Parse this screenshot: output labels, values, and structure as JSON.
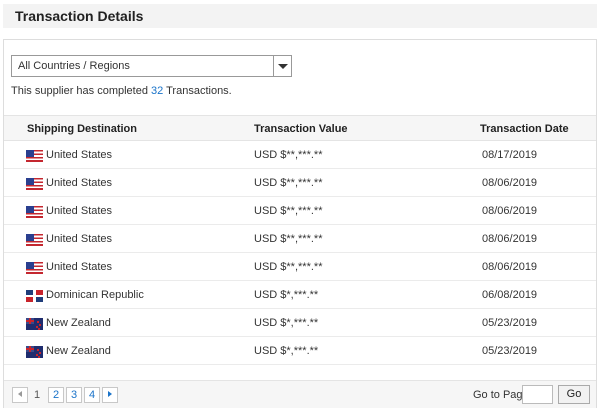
{
  "header": {
    "title": "Transaction Details"
  },
  "filter": {
    "selected": "All Countries / Regions"
  },
  "summary": {
    "prefix": "This supplier has completed ",
    "count": "32",
    "suffix": " Transactions."
  },
  "table": {
    "columns": [
      "Shipping Destination",
      "Transaction Value",
      "Transaction Date"
    ],
    "rows": [
      {
        "flag": "us-flag-icon",
        "country": "United States",
        "value": "USD $**,***.**",
        "date": "08/17/2019"
      },
      {
        "flag": "us-flag-icon",
        "country": "United States",
        "value": "USD $**,***.**",
        "date": "08/06/2019"
      },
      {
        "flag": "us-flag-icon",
        "country": "United States",
        "value": "USD $**,***.**",
        "date": "08/06/2019"
      },
      {
        "flag": "us-flag-icon",
        "country": "United States",
        "value": "USD $**,***.**",
        "date": "08/06/2019"
      },
      {
        "flag": "us-flag-icon",
        "country": "United States",
        "value": "USD $**,***.**",
        "date": "08/06/2019"
      },
      {
        "flag": "dominican-republic-flag-icon",
        "country": "Dominican Republic",
        "value": "USD $*,***.**",
        "date": "06/08/2019"
      },
      {
        "flag": "new-zealand-flag-icon",
        "country": "New Zealand",
        "value": "USD $*,***.**",
        "date": "05/23/2019"
      },
      {
        "flag": "new-zealand-flag-icon",
        "country": "New Zealand",
        "value": "USD $*,***.**",
        "date": "05/23/2019"
      }
    ]
  },
  "pagination": {
    "pages": [
      "1",
      "2",
      "3",
      "4"
    ],
    "current": "1",
    "goto_label": "Go to Page",
    "goto_value": "",
    "go_button": "Go"
  },
  "colors": {
    "link": "#1a73c9",
    "header_bg": "#f3f3f3",
    "table_header_bg": "#f6f6f6"
  }
}
